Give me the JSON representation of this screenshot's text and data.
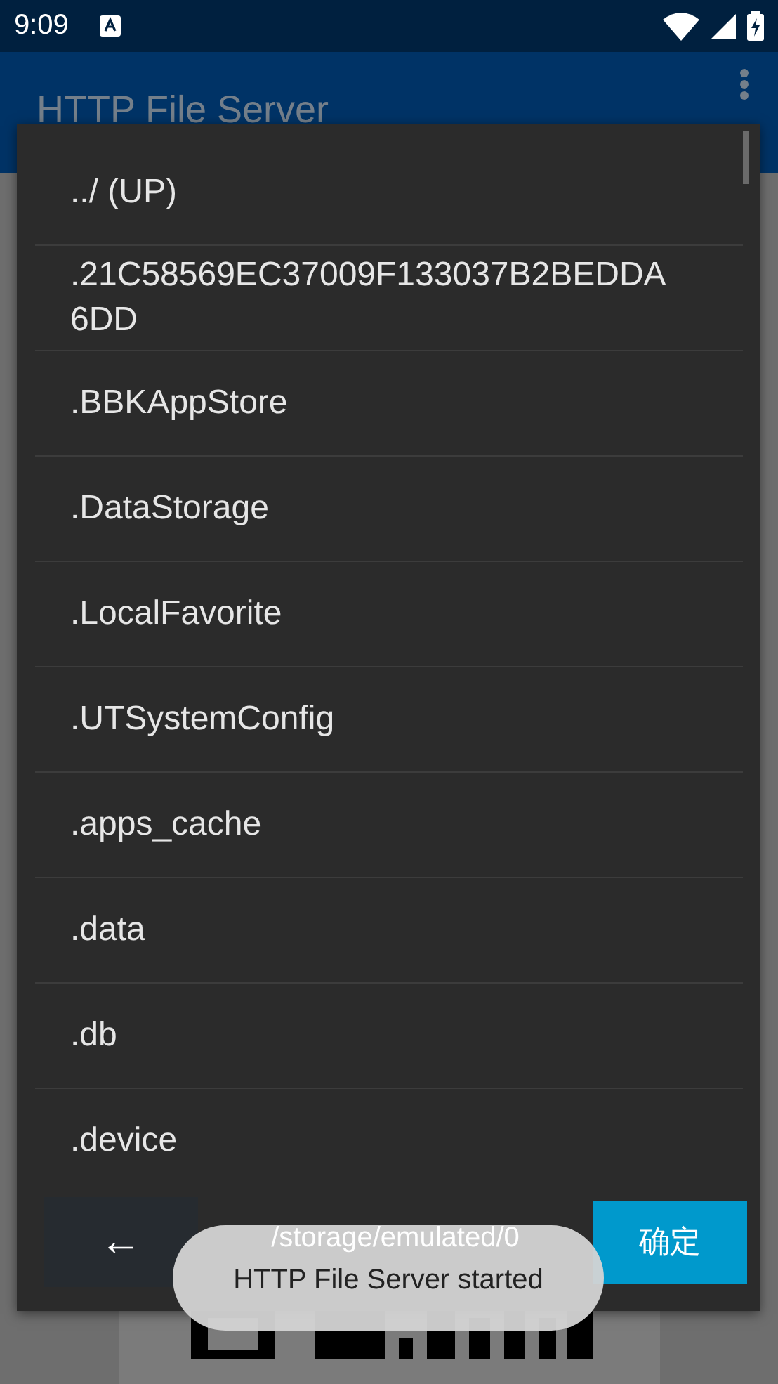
{
  "status_bar": {
    "time": "9:09"
  },
  "app_bar": {
    "title": "HTTP File Server"
  },
  "dialog": {
    "items": [
      {
        "label": "../ (UP)"
      },
      {
        "label": ".21C58569EC37009F133037B2BEDDA6DD"
      },
      {
        "label": ".BBKAppStore"
      },
      {
        "label": ".DataStorage"
      },
      {
        "label": ".LocalFavorite"
      },
      {
        "label": ".UTSystemConfig"
      },
      {
        "label": ".apps_cache"
      },
      {
        "label": ".data"
      },
      {
        "label": ".db"
      },
      {
        "label": ".device"
      }
    ],
    "back_button": "←",
    "path": "/storage/emulated/0",
    "ok_button": "确定"
  },
  "toast": "HTTP File Server started"
}
